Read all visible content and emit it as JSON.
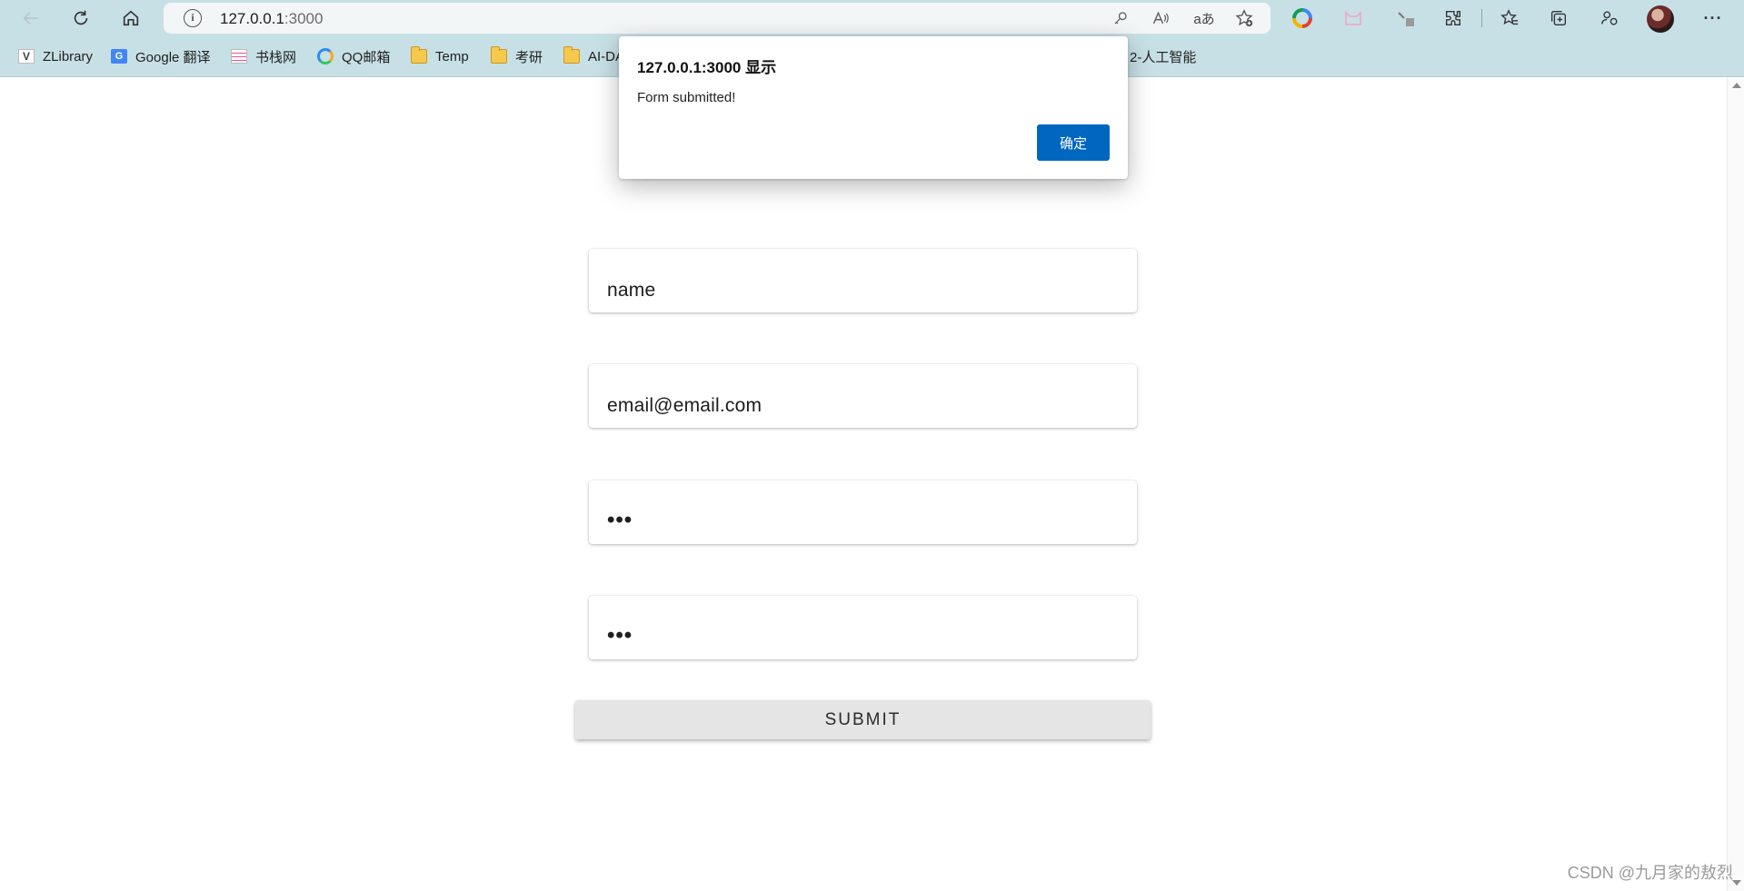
{
  "browser": {
    "url_host": "127.0.0.1",
    "url_port": ":3000",
    "toolbar_icons": [
      "back-icon",
      "refresh-icon",
      "home-icon",
      "password-key-icon",
      "read-aloud-icon",
      "translate-icon",
      "add-favorite-icon",
      "extension-color-wheel-icon",
      "extension-cat-icon",
      "extension-pin-icon",
      "extensions-puzzle-icon",
      "favorites-icon",
      "collections-icon",
      "profile-sync-icon",
      "more-icon"
    ],
    "translate_glyph": "aあ",
    "more_glyph": "···",
    "bookmarks": [
      {
        "label": "ZLibrary",
        "icon": "zlibrary-icon"
      },
      {
        "label": "Google 翻译",
        "icon": "google-translate-icon"
      },
      {
        "label": "书栈网",
        "icon": "bookstack-icon"
      },
      {
        "label": "QQ邮箱",
        "icon": "qq-mail-icon"
      },
      {
        "label": "Temp",
        "icon": "folder-icon"
      },
      {
        "label": "考研",
        "icon": "folder-icon"
      },
      {
        "label": "AI-DA",
        "icon": "folder-icon"
      },
      {
        "label": "2-人工智能",
        "icon": "folder-icon"
      }
    ]
  },
  "dialog": {
    "title": "127.0.0.1:3000 显示",
    "message": "Form submitted!",
    "ok_label": "确定"
  },
  "form": {
    "name_value": "name",
    "email_value": "email@email.com",
    "password_mask": "•••",
    "confirm_mask": "•••",
    "submit_label": "SUBMIT"
  },
  "watermark": "CSDN @九月家的敖烈",
  "colors": {
    "chrome_bg": "#c7e0e6",
    "dialog_button": "#0067c0",
    "submit_bg": "#e5e5e5"
  }
}
